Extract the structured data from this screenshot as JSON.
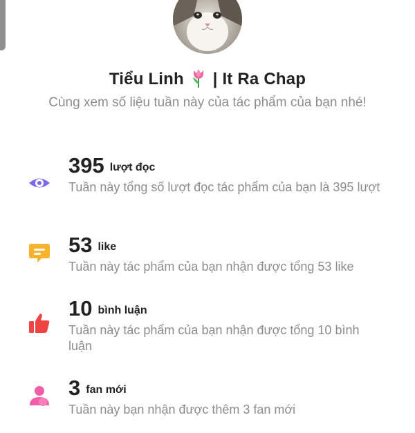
{
  "profile": {
    "name_part1": "Tiểu Linh",
    "name_part2": "| It Ra Chap",
    "subtitle": "Cùng xem số liệu tuần này của tác phẩm của bạn nhé!"
  },
  "stats": [
    {
      "value": "395",
      "unit": "lượt đọc",
      "description": "Tuần này tổng số lượt đọc tác phẩm của bạn là 395 lượt",
      "icon": "eye-icon",
      "color": "#7b68ee"
    },
    {
      "value": "53",
      "unit": "like",
      "description": "Tuần này tác phẩm của bạn nhận được tổng 53 like",
      "icon": "comment-icon",
      "color": "#f7b32b"
    },
    {
      "value": "10",
      "unit": "bình luận",
      "description": "Tuần này tác phẩm của bạn nhận được tổng 10 bình luận",
      "icon": "thumbs-up-icon",
      "color": "#ef4444"
    },
    {
      "value": "3",
      "unit": "fan mới",
      "description": "Tuần này bạn nhận được thêm 3 fan mới",
      "icon": "user-icon",
      "color": "#f25ca8"
    }
  ]
}
